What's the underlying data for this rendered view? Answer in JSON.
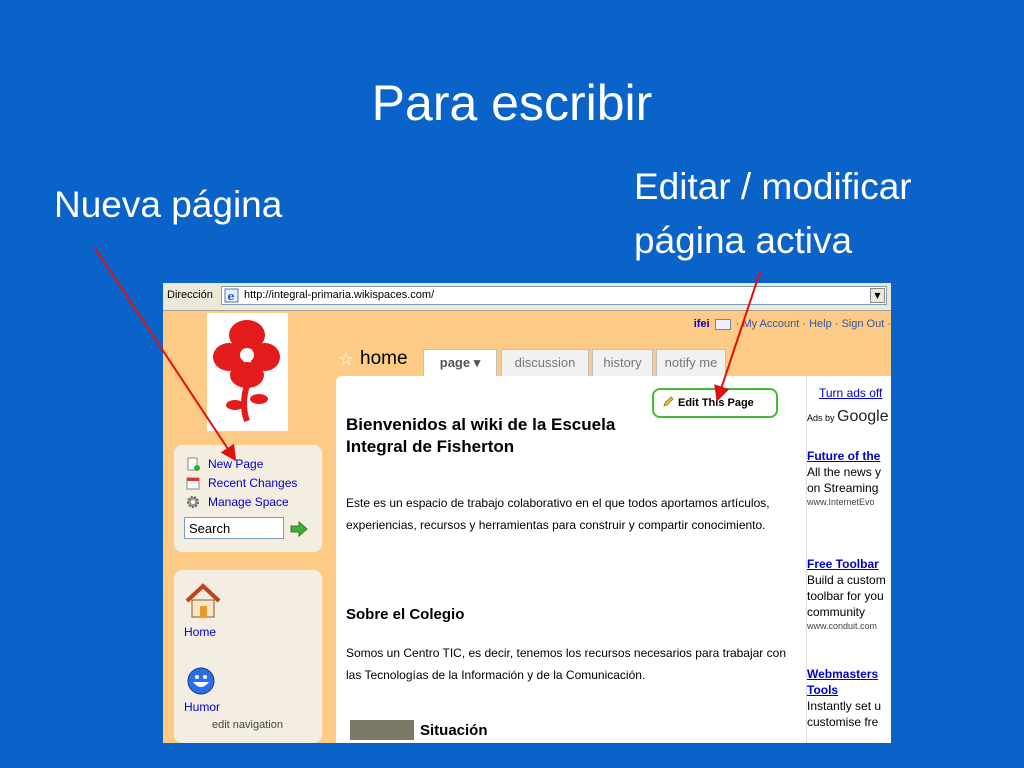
{
  "slide": {
    "title": "Para escribir",
    "callout_new": "Nueva página",
    "callout_edit": "Editar / modificar página activa"
  },
  "browser": {
    "address_label": "Dirección",
    "url": "http://integral-primaria.wikispaces.com/"
  },
  "userbar": {
    "username": "ifei",
    "links": "· My Account · Help · Sign Out ·"
  },
  "wiki": {
    "page_name": "home",
    "tabs": [
      {
        "label": "page ▾"
      },
      {
        "label": "discussion"
      },
      {
        "label": "history"
      },
      {
        "label": "notify me"
      }
    ],
    "edit_button": "Edit This Page",
    "heading": "Bienvenidos al wiki de la Escuela Integral de Fisherton",
    "intro": "Este es un espacio de trabajo colaborativo en el que todos aportamos artículos, experiencias, recursos y herramientas para construir y compartir conocimiento.",
    "section1_title": "Sobre el Colegio",
    "section1_text": "Somos un Centro TIC, es decir, tenemos los recursos necesarios para trabajar con las Tecnologías de la Información y de la Comunicación.",
    "section2_title": "Situación"
  },
  "sidebar": {
    "tools": [
      {
        "label": "New Page"
      },
      {
        "label": "Recent Changes"
      },
      {
        "label": "Manage Space"
      }
    ],
    "search_value": "Search",
    "nav": [
      {
        "label": "Home"
      },
      {
        "label": "Humor"
      }
    ],
    "edit_navigation": "edit navigation"
  },
  "ads": {
    "turn_off": "Turn ads off",
    "ads_by": "Ads by",
    "google": "Google",
    "items": [
      {
        "title": "Future of the",
        "text": "All the news y on Streaming",
        "url": "www.InternetEvo"
      },
      {
        "title": "Free Toolbar",
        "text": "Build a custom toolbar for you community",
        "url": "www.conduit.com"
      },
      {
        "title": "Webmasters Tools",
        "text": "Instantly set u customise fre",
        "url": ""
      }
    ]
  },
  "colors": {
    "slide_bg": "#0a63c9",
    "wiki_bg": "#fecb86",
    "edit_border": "#44bb33",
    "arrow": "#e01010"
  }
}
